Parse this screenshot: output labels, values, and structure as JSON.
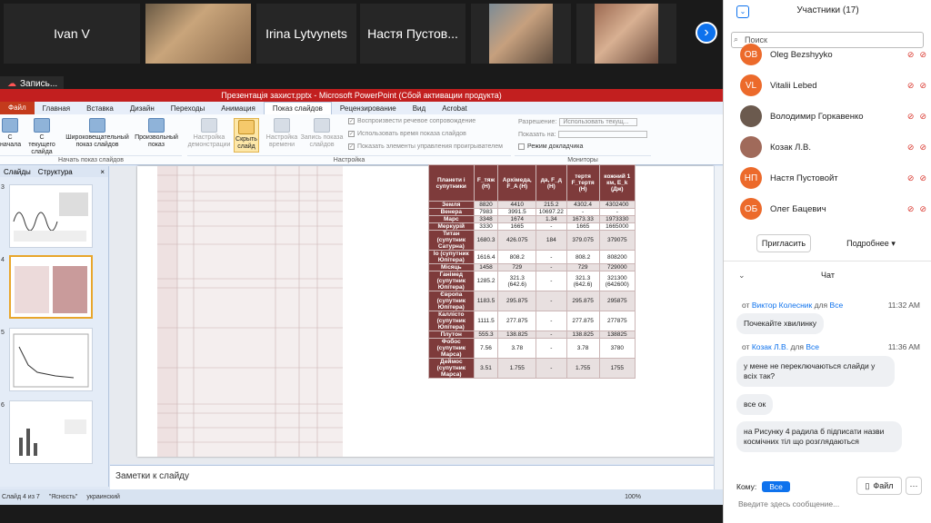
{
  "video_strip": {
    "tiles": [
      {
        "name": "Ivan V"
      },
      {
        "name": "Irina Lytvynets"
      },
      {
        "name": "Настя Пустов..."
      }
    ]
  },
  "recording": {
    "label": "Запись..."
  },
  "ppt": {
    "window_title": "Презентація захист.pptx  -  Microsoft PowerPoint (Сбой активации продукта)",
    "tabs": [
      "Файл",
      "Главная",
      "Вставка",
      "Дизайн",
      "Переходы",
      "Анимация",
      "Показ слайдов",
      "Рецензирование",
      "Вид",
      "Acrobat"
    ],
    "active_tab": "Показ слайдов",
    "ribbon": {
      "btn_start": "С начала",
      "btn_current": "С текущего слайда",
      "btn_broadcast": "Широковещательный показ слайдов",
      "btn_custom": "Произвольный показ",
      "grp_start": "Начать показ слайдов",
      "btn_setup": "Настройка демонстрации",
      "btn_hide": "Скрыть слайд",
      "btn_timing": "Настройка времени",
      "btn_record": "Запись показа слайдов",
      "grp_setup": "Настройка",
      "chk1": "Воспроизвести речевое сопровождение",
      "chk2": "Использовать время показа слайдов",
      "chk3": "Показать элементы управления проигрывателем",
      "res_label": "Разрешение:",
      "res_value": "Использовать текущ...",
      "show_on_label": "Показать на:",
      "presenter_mode": "Режим докладчика",
      "grp_monitors": "Мониторы"
    },
    "left_pane": {
      "tab_slides": "Слайды",
      "tab_outline": "Структура",
      "numbers": [
        "3",
        "4",
        "5",
        "6"
      ]
    },
    "notes_placeholder": "Заметки к слайду",
    "status": {
      "slide": "Слайд 4 из 7",
      "theme": "\"Ясность\"",
      "lang": "украинский",
      "zoom": "100%"
    },
    "table2": {
      "headers": [
        "Планети і супутники",
        "F_тяж (Н)",
        "Архімеда, F_A (Н)",
        "да, F_д (Н)",
        "тертя F_тертя (Н)",
        "кожний 1 км, E_k (Дж)"
      ],
      "rows": [
        [
          "Земля",
          "8820",
          "4410",
          "215.2",
          "4302.4",
          "4302400"
        ],
        [
          "Венера",
          "7983",
          "3991.5",
          "10697.22",
          "-",
          "-"
        ],
        [
          "Марс",
          "3348",
          "1674",
          "1.34",
          "1673.33",
          "1973330"
        ],
        [
          "Меркурій",
          "3330",
          "1665",
          "-",
          "1665",
          "1665000"
        ],
        [
          "Титан (супутник Сатурна)",
          "1680.3",
          "426.075",
          "184",
          "379.075",
          "379075"
        ],
        [
          "Іо (супутник Юпітера)",
          "1616.4",
          "808.2",
          "-",
          "808.2",
          "808200"
        ],
        [
          "Місяць",
          "1458",
          "729",
          "-",
          "729",
          "729000"
        ],
        [
          "Ганімед (супутник Юпітера)",
          "1285.2",
          "321.3 (642.6)",
          "-",
          "321.3 (642.6)",
          "321300 (642600)"
        ],
        [
          "Європа (супутник Юпітера)",
          "1183.5",
          "295.875",
          "-",
          "295.875",
          "295875"
        ],
        [
          "Каллісто (супутник Юпітера)",
          "1111.5",
          "277.875",
          "-",
          "277.875",
          "277875"
        ],
        [
          "Плутон",
          "555.3",
          "138.825",
          "-",
          "138.825",
          "138825"
        ],
        [
          "Фобос (супутник Марса)",
          "7.56",
          "3.78",
          "-",
          "3.78",
          "3780"
        ],
        [
          "Деймос (супутник Марса)",
          "3.51",
          "1.755",
          "-",
          "1.755",
          "1755"
        ]
      ]
    }
  },
  "participants": {
    "title": "Участники (17)",
    "search_placeholder": "Поиск",
    "list": [
      {
        "initials": "OB",
        "name": "Oleg Bezshyyko"
      },
      {
        "initials": "VL",
        "name": "Vitalii Lebed"
      },
      {
        "initials": "",
        "name": "Володимир Горкавенко"
      },
      {
        "initials": "",
        "name": "Козак Л.В."
      },
      {
        "initials": "НП",
        "name": "Настя Пустовойт"
      },
      {
        "initials": "ОБ",
        "name": "Олег Бацевич"
      }
    ],
    "invite": "Пригласить",
    "more": "Подробнее ▾"
  },
  "chat": {
    "title": "Чат",
    "messages": [
      {
        "from": "Виктор Колесник",
        "to": "Все",
        "time": "11:32 AM",
        "texts": [
          "Почекайте хвилинку"
        ]
      },
      {
        "from": "Козак Л.В.",
        "to": "Все",
        "time": "11:36 AM",
        "texts": [
          "у мене не переключаються слайди у всіх так?",
          "все ок",
          "на Рисунку 4 радила б підписати назви космічних тіл що розглядаються"
        ]
      }
    ],
    "from_word": "от",
    "for_word": "для",
    "to_label": "Кому:",
    "to_value": "Все",
    "file_label": "Файл",
    "compose_placeholder": "Введите здесь сообщение..."
  },
  "colors": {
    "zoom_blue": "#0e72ed",
    "ppt_red": "#c21f1f",
    "avatar_orange": "#ec6a2b",
    "table_header": "#7e3b3b"
  }
}
